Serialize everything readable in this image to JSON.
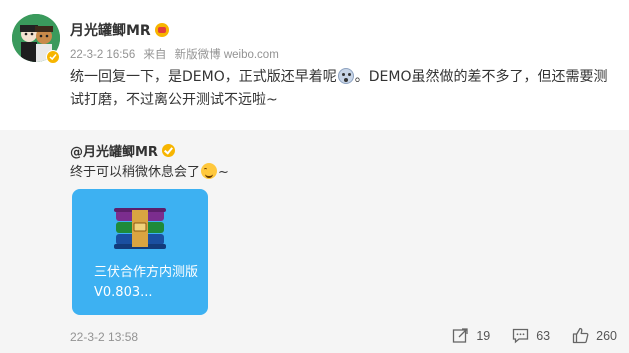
{
  "post": {
    "username": "月光罐鲫MR",
    "date": "22-3-2 16:56",
    "source_prefix": "来自",
    "source": "新版微博 weibo.com",
    "content_part1": "统一回复一下，是DEMO，正式版还早着呢",
    "content_part2": "。DEMO虽然做的差不多了，但还需要测试打磨，不过离公开测试不远啦~"
  },
  "repost": {
    "username": "@月光罐鲫MR",
    "text_part1": "终于可以稍微休息会了",
    "text_part2": "~",
    "file": {
      "name": "三伏合作方内测版V0.803..."
    },
    "date": "22-3-2 13:58",
    "actions": {
      "share_count": "19",
      "comment_count": "63",
      "like_count": "260"
    }
  }
}
